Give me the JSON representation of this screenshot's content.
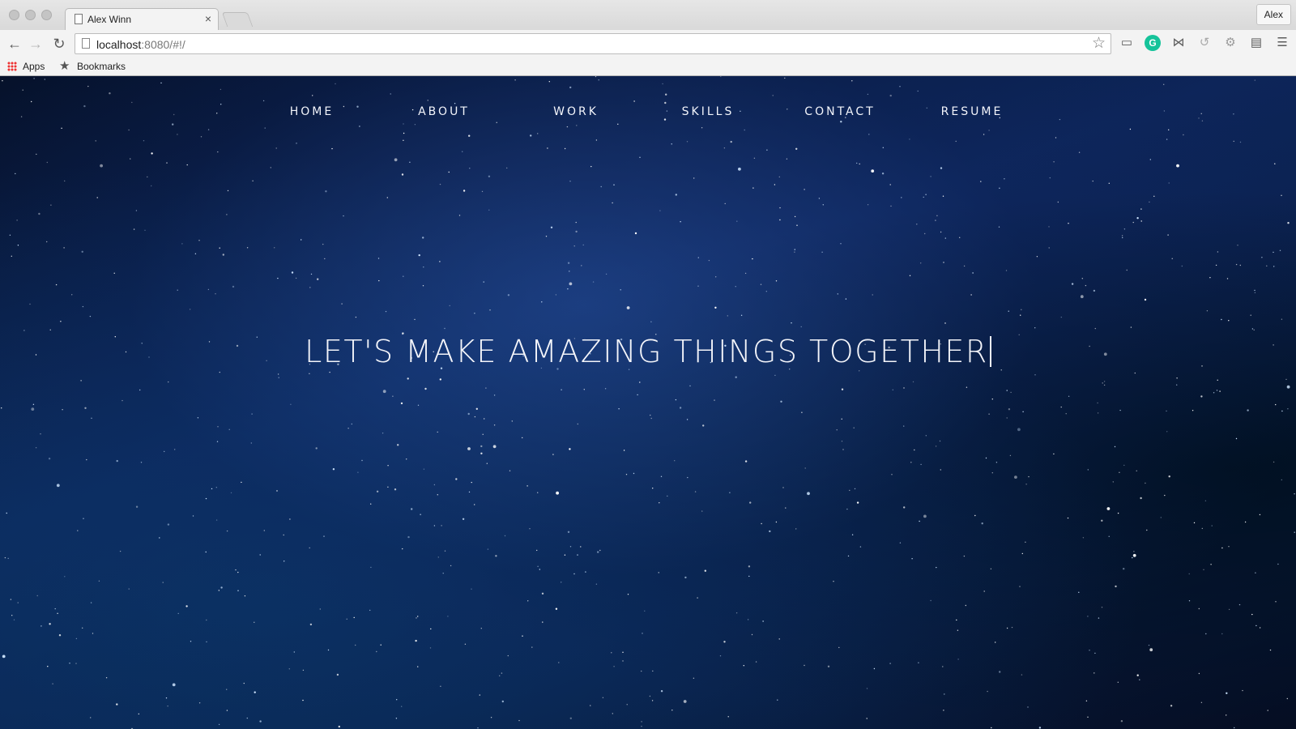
{
  "browser": {
    "tab_title": "Alex Winn",
    "tab_close": "×",
    "profile_name": "Alex",
    "url_host": "localhost",
    "url_rest": ":8080/#!/",
    "bookmarks": {
      "apps_label": "Apps",
      "bookmarks_label": "Bookmarks"
    },
    "icons": {
      "back": "back-arrow-icon",
      "forward": "forward-arrow-icon",
      "reload": "reload-icon",
      "bookmark_star": "star-icon",
      "cast": "cast-icon",
      "grammarly": "grammarly-icon",
      "extension_2": "bowtie-extension-icon",
      "extension_3": "swirl-extension-icon",
      "extension_4": "gear-extension-icon",
      "extension_5": "screen-extension-icon",
      "menu": "hamburger-menu-icon"
    }
  },
  "site": {
    "nav": [
      "HOME",
      "ABOUT",
      "WORK",
      "SKILLS",
      "CONTACT",
      "RESUME"
    ],
    "hero_text": "LET'S MAKE AMAZING THINGS TOGETHER"
  },
  "colors": {
    "sky_dark": "#051027",
    "sky_mid": "#0d2559",
    "text": "#f2f4fa",
    "grammarly": "#15c39a"
  }
}
